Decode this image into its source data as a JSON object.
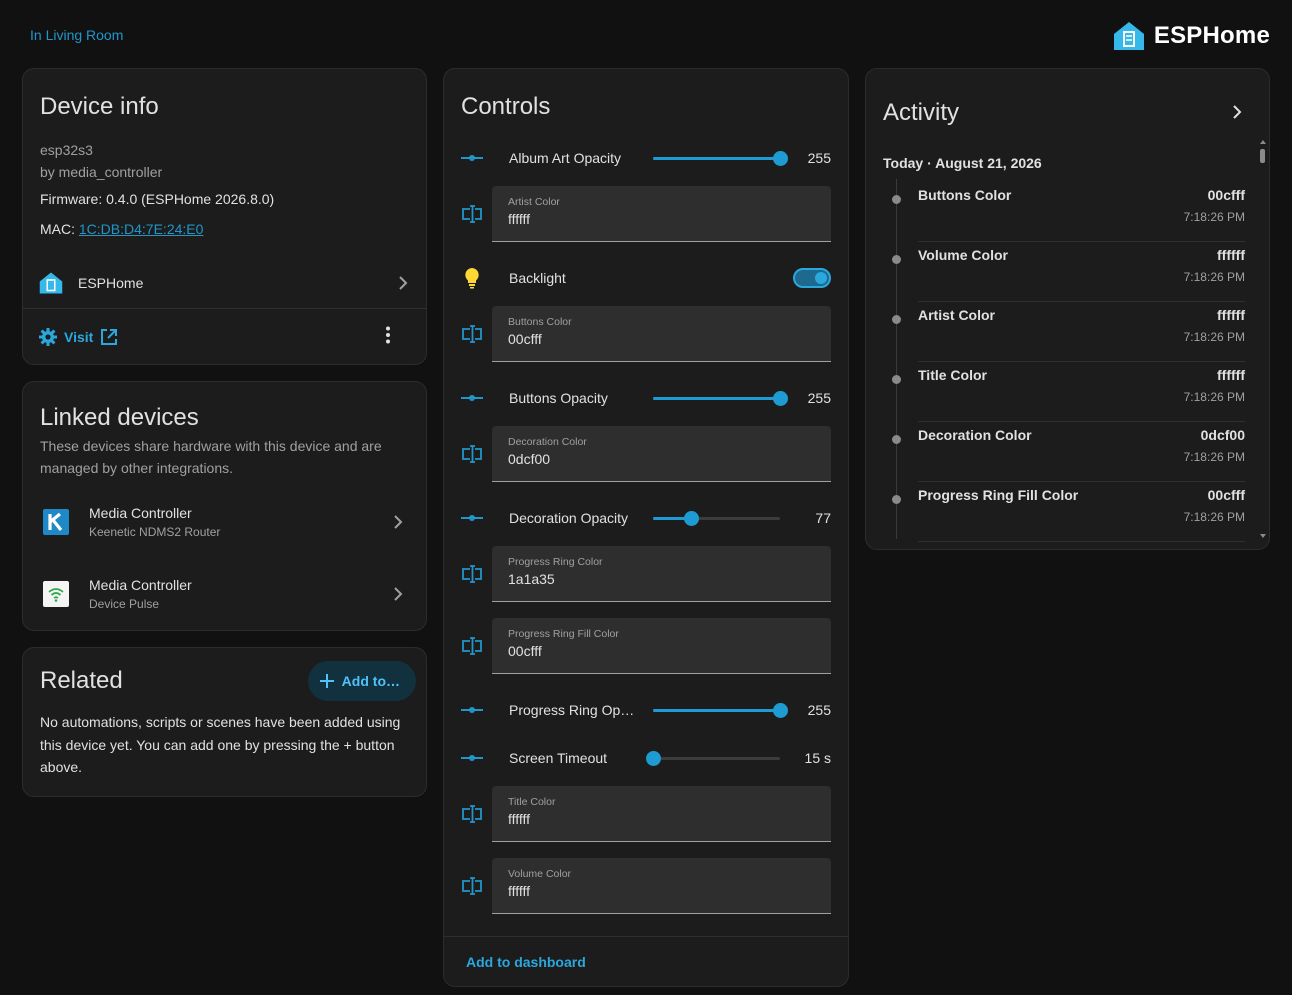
{
  "header": {
    "area_link": "In Living Room",
    "brand_name": "ESPHome"
  },
  "device_info": {
    "title": "Device info",
    "model": "esp32s3",
    "manufacturer": "by media_controller",
    "firmware": "Firmware: 0.4.0 (ESPHome 2026.8.0)",
    "mac_label": "MAC: ",
    "mac_value": "1C:DB:D4:7E:24:E0",
    "integration_label": "ESPHome",
    "visit_label": "Visit"
  },
  "linked": {
    "title": "Linked devices",
    "description": "These devices share hardware with this device and are managed by other integrations.",
    "items": [
      {
        "name": "Media Controller",
        "source": "Keenetic NDMS2 Router"
      },
      {
        "name": "Media Controller",
        "source": "Device Pulse"
      }
    ]
  },
  "related": {
    "title": "Related",
    "add_button": "Add to…",
    "text": "No automations, scripts or scenes have been added using this device yet. You can add one by pressing the + button above."
  },
  "controls": {
    "title": "Controls",
    "footer": "Add to dashboard",
    "sliders": [
      {
        "name": "Album Art Opacity",
        "value": "255",
        "fraction": 1.0
      },
      {
        "name": "Buttons Opacity",
        "value": "255",
        "fraction": 1.0
      },
      {
        "name": "Decoration Opacity",
        "value": "77",
        "fraction": 0.3
      },
      {
        "name": "Progress Ring Op…",
        "value": "255",
        "fraction": 1.0
      },
      {
        "name": "Screen Timeout",
        "value": "15 s",
        "fraction": 0.0
      }
    ],
    "texts": [
      {
        "label": "Artist Color",
        "value": "ffffff"
      },
      {
        "label": "Buttons Color",
        "value": "00cfff"
      },
      {
        "label": "Decoration Color",
        "value": "0dcf00"
      },
      {
        "label": "Progress Ring Color",
        "value": "1a1a35"
      },
      {
        "label": "Progress Ring Fill Color",
        "value": "00cfff"
      },
      {
        "label": "Title Color",
        "value": "ffffff"
      },
      {
        "label": "Volume Color",
        "value": "ffffff"
      }
    ],
    "backlight": {
      "name": "Backlight",
      "on": true
    }
  },
  "activity": {
    "title": "Activity",
    "date": "Today · August 21, 2026",
    "items": [
      {
        "name": "Buttons Color",
        "state": "00cfff",
        "time": "7:18:26 PM"
      },
      {
        "name": "Volume Color",
        "state": "ffffff",
        "time": "7:18:26 PM"
      },
      {
        "name": "Artist Color",
        "state": "ffffff",
        "time": "7:18:26 PM"
      },
      {
        "name": "Title Color",
        "state": "ffffff",
        "time": "7:18:26 PM"
      },
      {
        "name": "Decoration Color",
        "state": "0dcf00",
        "time": "7:18:26 PM"
      },
      {
        "name": "Progress Ring Fill Color",
        "state": "00cfff",
        "time": "7:18:26 PM"
      }
    ]
  },
  "colors": {
    "accent": "#1e9bd3",
    "background": "#111111",
    "card": "#1c1c1c"
  },
  "icons": [
    "esphome-house-icon",
    "gear-icon",
    "open-in-new-icon",
    "more-vertical-icon",
    "chevron-right-icon",
    "keenetic-logo-icon",
    "device-pulse-icon",
    "plus-icon",
    "slider-icon",
    "text-field-icon",
    "lightbulb-icon"
  ]
}
